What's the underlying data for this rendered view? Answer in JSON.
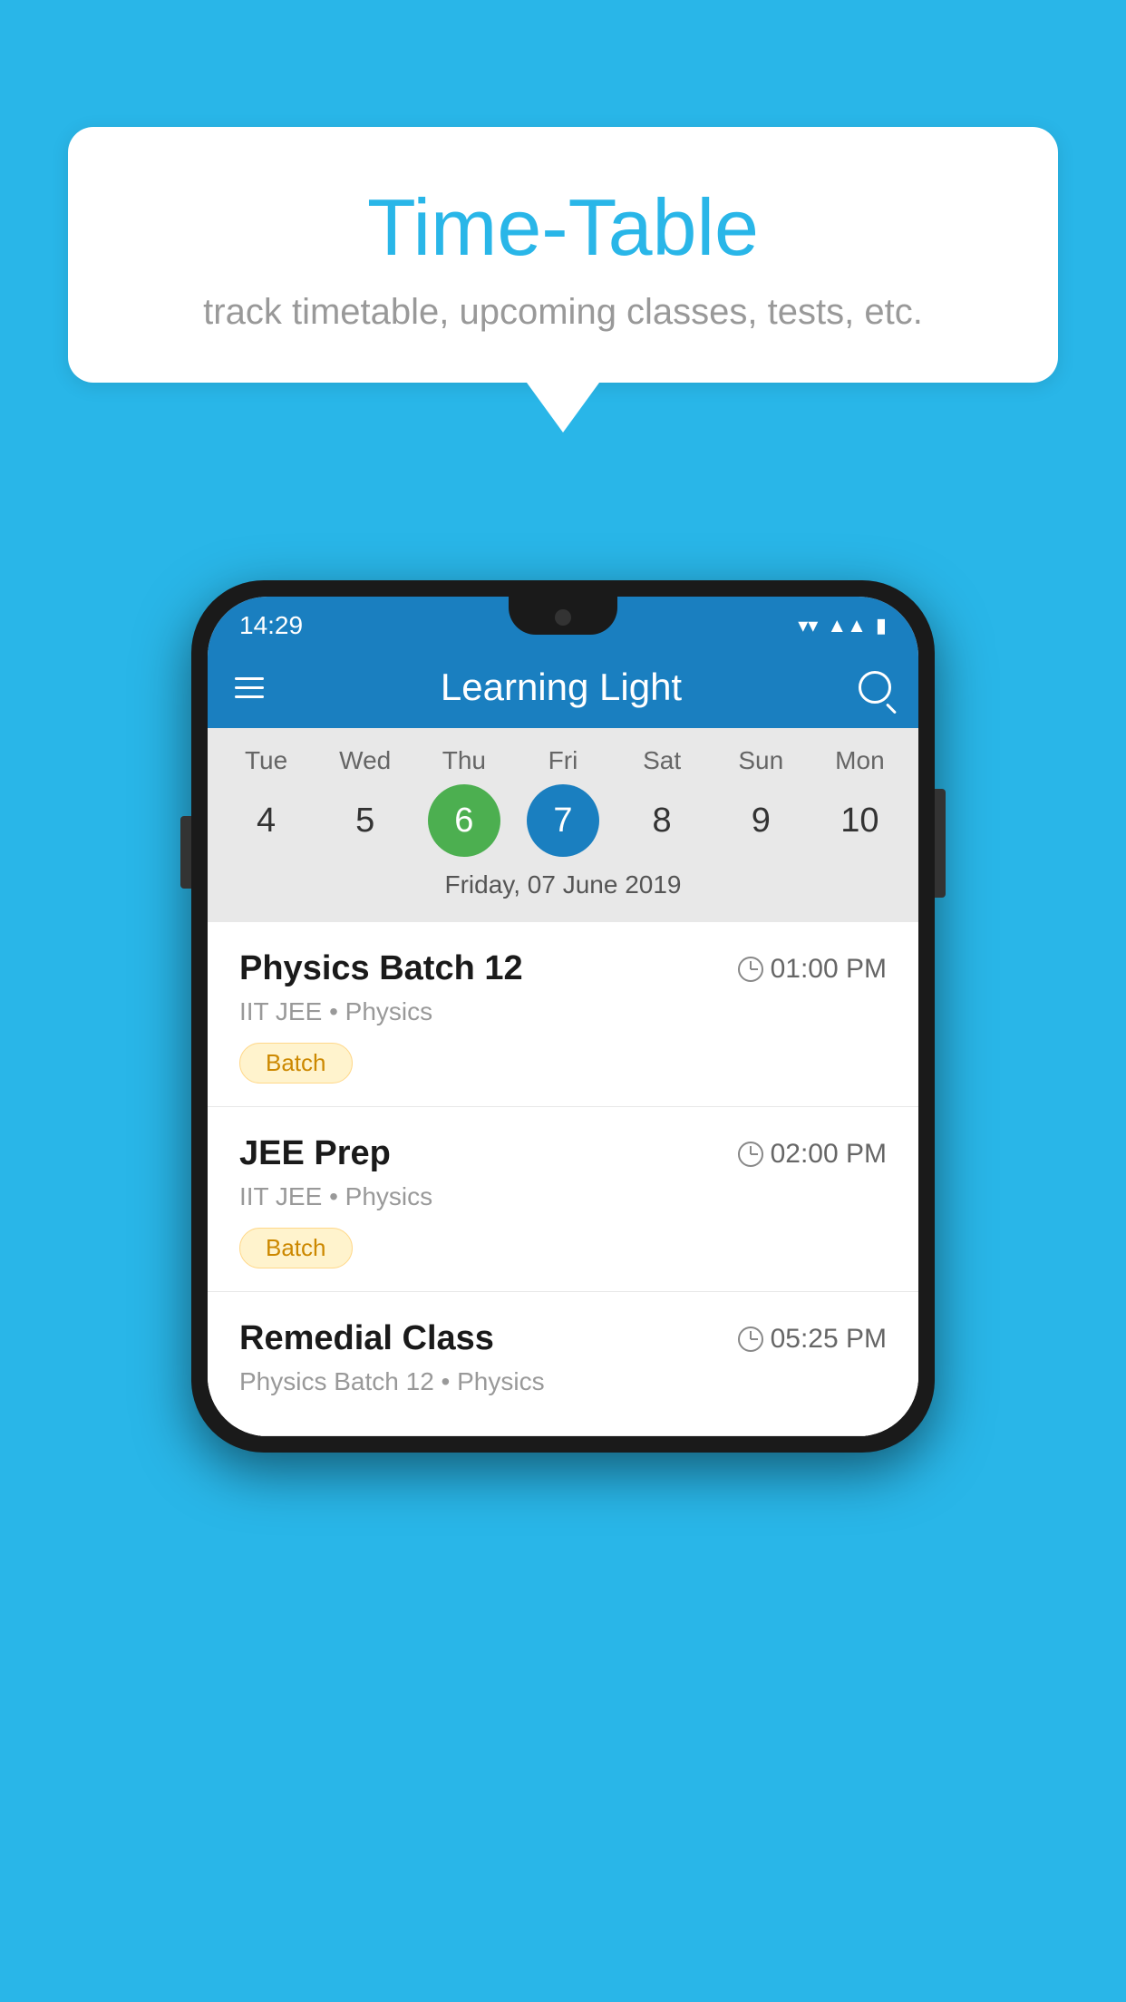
{
  "background_color": "#29B6E8",
  "speech_bubble": {
    "title": "Time-Table",
    "subtitle": "track timetable, upcoming classes, tests, etc."
  },
  "phone": {
    "status_bar": {
      "time": "14:29"
    },
    "app_bar": {
      "title": "Learning Light"
    },
    "calendar": {
      "days": [
        "Tue",
        "Wed",
        "Thu",
        "Fri",
        "Sat",
        "Sun",
        "Mon"
      ],
      "dates": [
        "4",
        "5",
        "6",
        "7",
        "8",
        "9",
        "10"
      ],
      "today_index": 2,
      "selected_index": 3,
      "selected_label": "Friday, 07 June 2019"
    },
    "classes": [
      {
        "title": "Physics Batch 12",
        "time": "01:00 PM",
        "subtitle": "IIT JEE • Physics",
        "badge": "Batch"
      },
      {
        "title": "JEE Prep",
        "time": "02:00 PM",
        "subtitle": "IIT JEE • Physics",
        "badge": "Batch"
      },
      {
        "title": "Remedial Class",
        "time": "05:25 PM",
        "subtitle": "Physics Batch 12 • Physics",
        "badge": ""
      }
    ]
  }
}
